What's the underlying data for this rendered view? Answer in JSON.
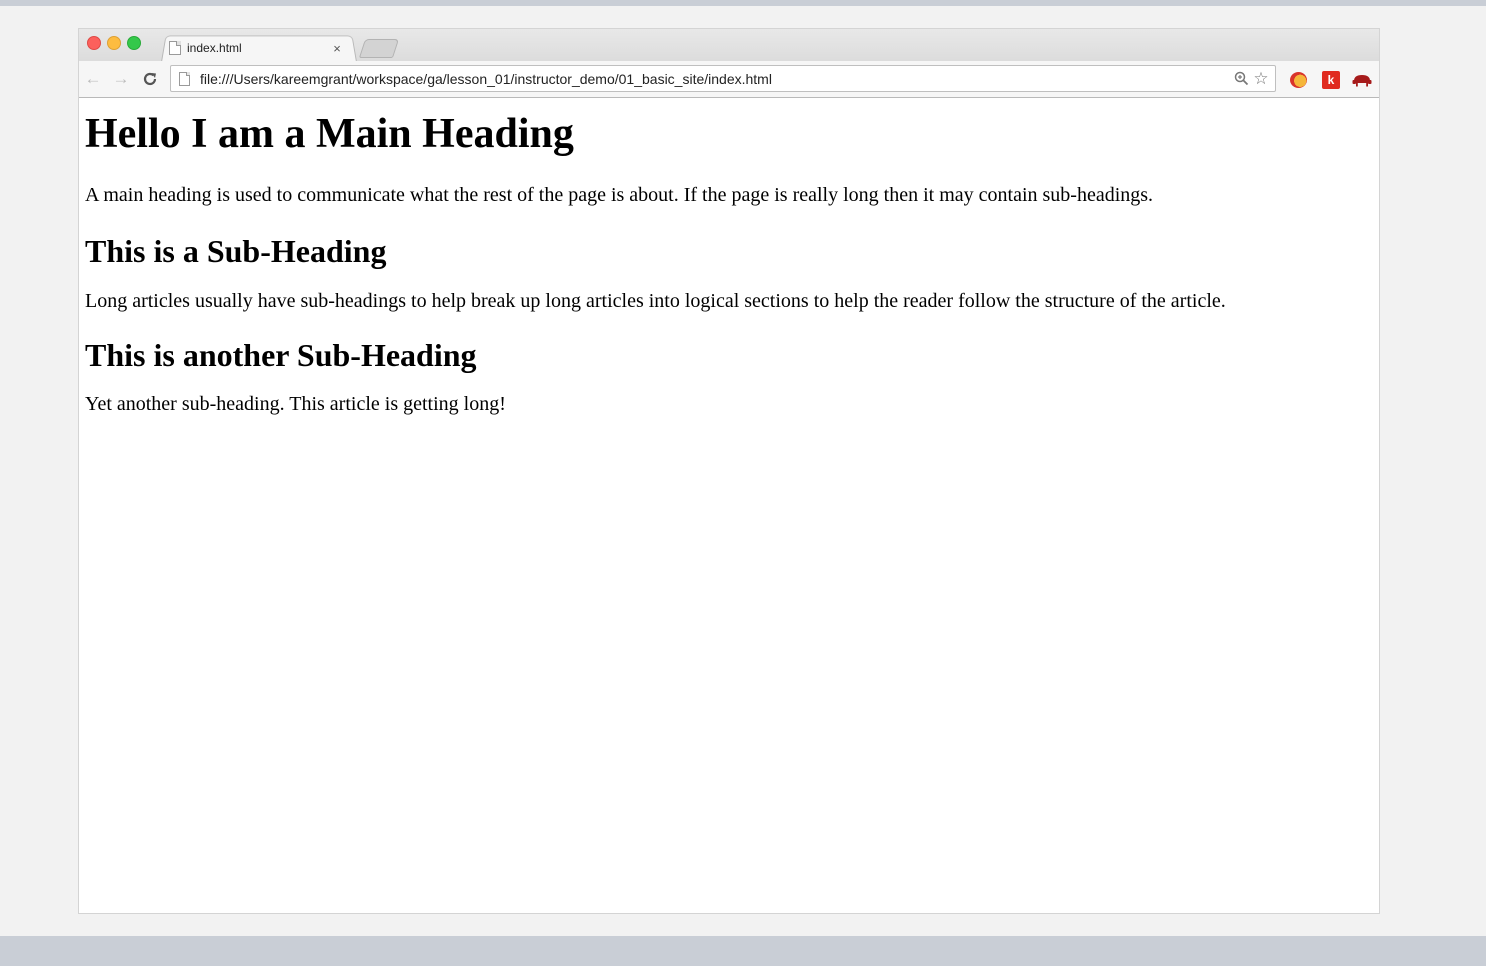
{
  "browser": {
    "tab": {
      "title": "index.html",
      "close_symbol": "×"
    },
    "toolbar": {
      "back_symbol": "←",
      "forward_symbol": "→",
      "reload_symbol": "C",
      "url": "file:///Users/kareemgrant/workspace/ga/lesson_01/instructor_demo/01_basic_site/index.html",
      "zoom_symbol": "⊕",
      "star_symbol": "☆"
    },
    "extensions": [
      {
        "name": "tampermonkey-icon"
      },
      {
        "name": "k-extension-icon",
        "letter": "k"
      },
      {
        "name": "chair-extension-icon"
      }
    ]
  },
  "content": {
    "main_heading": "Hello I am a Main Heading",
    "intro": "A main heading is used to communicate what the rest of the page is about. If the page is really long then it may contain sub-headings.",
    "sub_heading_1": "This is a Sub-Heading",
    "paragraph_1": "Long articles usually have sub-headings to help break up long articles into logical sections to help the reader follow the structure of the article.",
    "sub_heading_2": "This is another Sub-Heading",
    "paragraph_2": "Yet another sub-heading. This article is getting long!"
  },
  "colors": {
    "close": "#fc605c",
    "minimize": "#fdbc40",
    "maximize": "#34c84a",
    "extension_red": "#e02b20"
  }
}
